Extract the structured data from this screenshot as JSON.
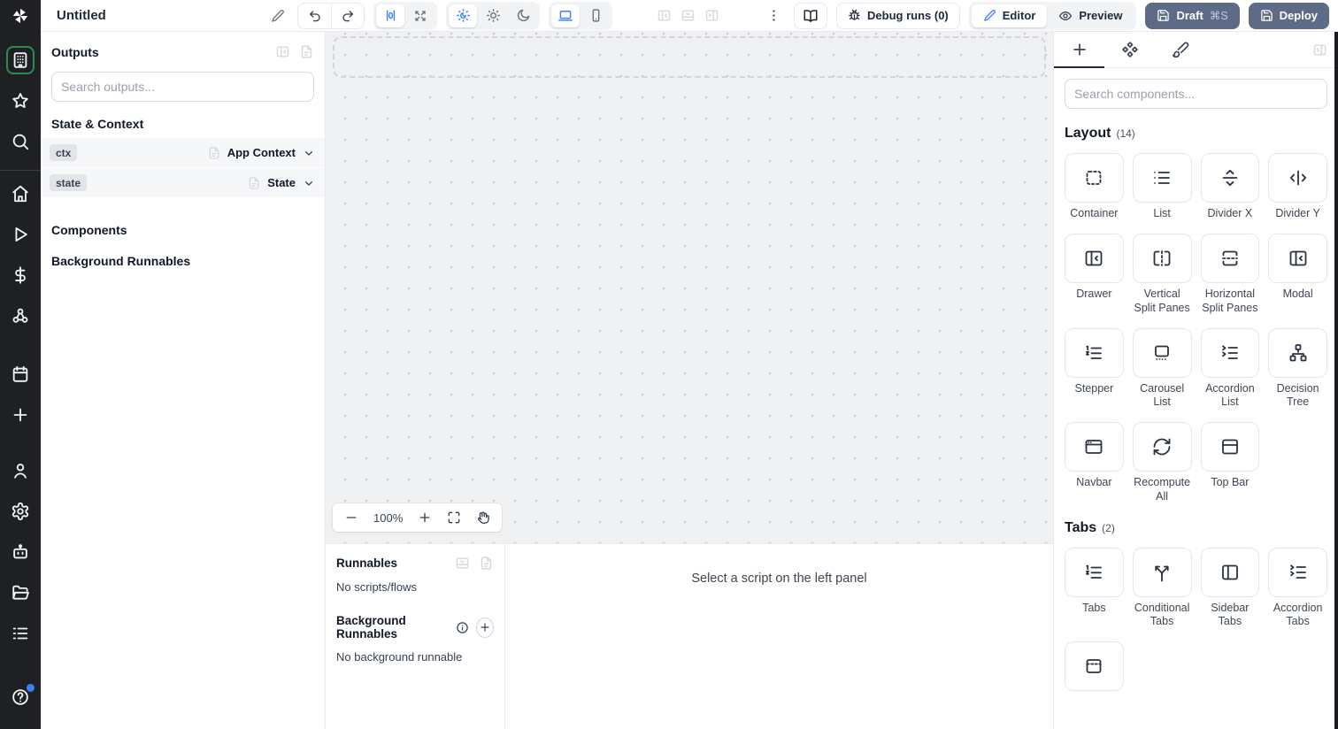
{
  "topbar": {
    "title": "Untitled",
    "debug_runs_label": "Debug runs (0)",
    "editor_label": "Editor",
    "preview_label": "Preview",
    "draft_label": "Draft",
    "draft_shortcut": "⌘S",
    "deploy_label": "Deploy",
    "icons": [
      "pencil",
      "undo",
      "redo",
      "align-center",
      "expand",
      "sun-moon",
      "sun",
      "moon",
      "laptop",
      "smartphone",
      "panel-left",
      "panel-bottom",
      "panel-right",
      "kebab-menu",
      "book-open",
      "bug",
      "eye",
      "save"
    ]
  },
  "colors": {
    "accent_blue": "#3b82f6",
    "active_green": "#2f8a4d",
    "slate_button": "#5d6b87",
    "sidebar_bg": "#1e2024"
  },
  "sidebar": {
    "groups": [
      {
        "divider_after": true,
        "items": [
          {
            "icon": "apps",
            "active": true
          },
          {
            "icon": "star"
          },
          {
            "icon": "search"
          }
        ]
      },
      {
        "items": [
          {
            "icon": "home"
          },
          {
            "icon": "play"
          },
          {
            "icon": "dollar"
          },
          {
            "icon": "hub"
          }
        ]
      },
      {
        "gap_before": 22,
        "items": [
          {
            "icon": "calendar"
          },
          {
            "icon": "plus"
          }
        ]
      },
      {
        "push": true,
        "items": [
          {
            "icon": "user"
          },
          {
            "icon": "settings"
          },
          {
            "icon": "bot"
          },
          {
            "icon": "folder"
          },
          {
            "icon": "list-menu"
          }
        ]
      },
      {
        "gap_before": 28,
        "items": [
          {
            "icon": "help",
            "notification": true
          }
        ]
      }
    ]
  },
  "outputs_panel": {
    "title": "Outputs",
    "search_placeholder": "Search outputs...",
    "state_context_label": "State & Context",
    "components_label": "Components",
    "background_runnables_label": "Background Runnables",
    "rows": [
      {
        "badge": "ctx",
        "type": "App Context"
      },
      {
        "badge": "state",
        "type": "State"
      }
    ]
  },
  "canvas": {
    "zoom_level": "100%"
  },
  "runnables_panel": {
    "title": "Runnables",
    "empty_text": "No scripts/flows",
    "background_title": "Background Runnables",
    "background_empty_text": "No background runnable",
    "detail_placeholder": "Select a script on the left panel"
  },
  "right_panel": {
    "search_placeholder": "Search components...",
    "sections": [
      {
        "title": "Layout",
        "count": "(14)",
        "items": [
          {
            "label": "Container",
            "icon": "container"
          },
          {
            "label": "List",
            "icon": "list"
          },
          {
            "label": "Divider X",
            "icon": "divider-x"
          },
          {
            "label": "Divider Y",
            "icon": "divider-y"
          },
          {
            "label": "Drawer",
            "icon": "panel-left"
          },
          {
            "label": "Vertical Split Panes",
            "icon": "vsplit"
          },
          {
            "label": "Horizontal Split Panes",
            "icon": "hsplit"
          },
          {
            "label": "Modal",
            "icon": "panel-left"
          },
          {
            "label": "Stepper",
            "icon": "stepper"
          },
          {
            "label": "Carousel List",
            "icon": "carousel"
          },
          {
            "label": "Accordion List",
            "icon": "accordion"
          },
          {
            "label": "Decision Tree",
            "icon": "tree"
          },
          {
            "label": "Navbar",
            "icon": "navbar"
          },
          {
            "label": "Recompute All",
            "icon": "refresh"
          },
          {
            "label": "Top Bar",
            "icon": "topbar"
          }
        ]
      },
      {
        "title": "Tabs",
        "count": "(2)",
        "items": [
          {
            "label": "Tabs",
            "icon": "stepper"
          },
          {
            "label": "Conditional Tabs",
            "icon": "split"
          },
          {
            "label": "Sidebar Tabs",
            "icon": "sidebar-tabs"
          },
          {
            "label": "Accordion Tabs",
            "icon": "accordion"
          },
          {
            "label": "",
            "icon": "invisible-tabs"
          }
        ]
      }
    ]
  }
}
